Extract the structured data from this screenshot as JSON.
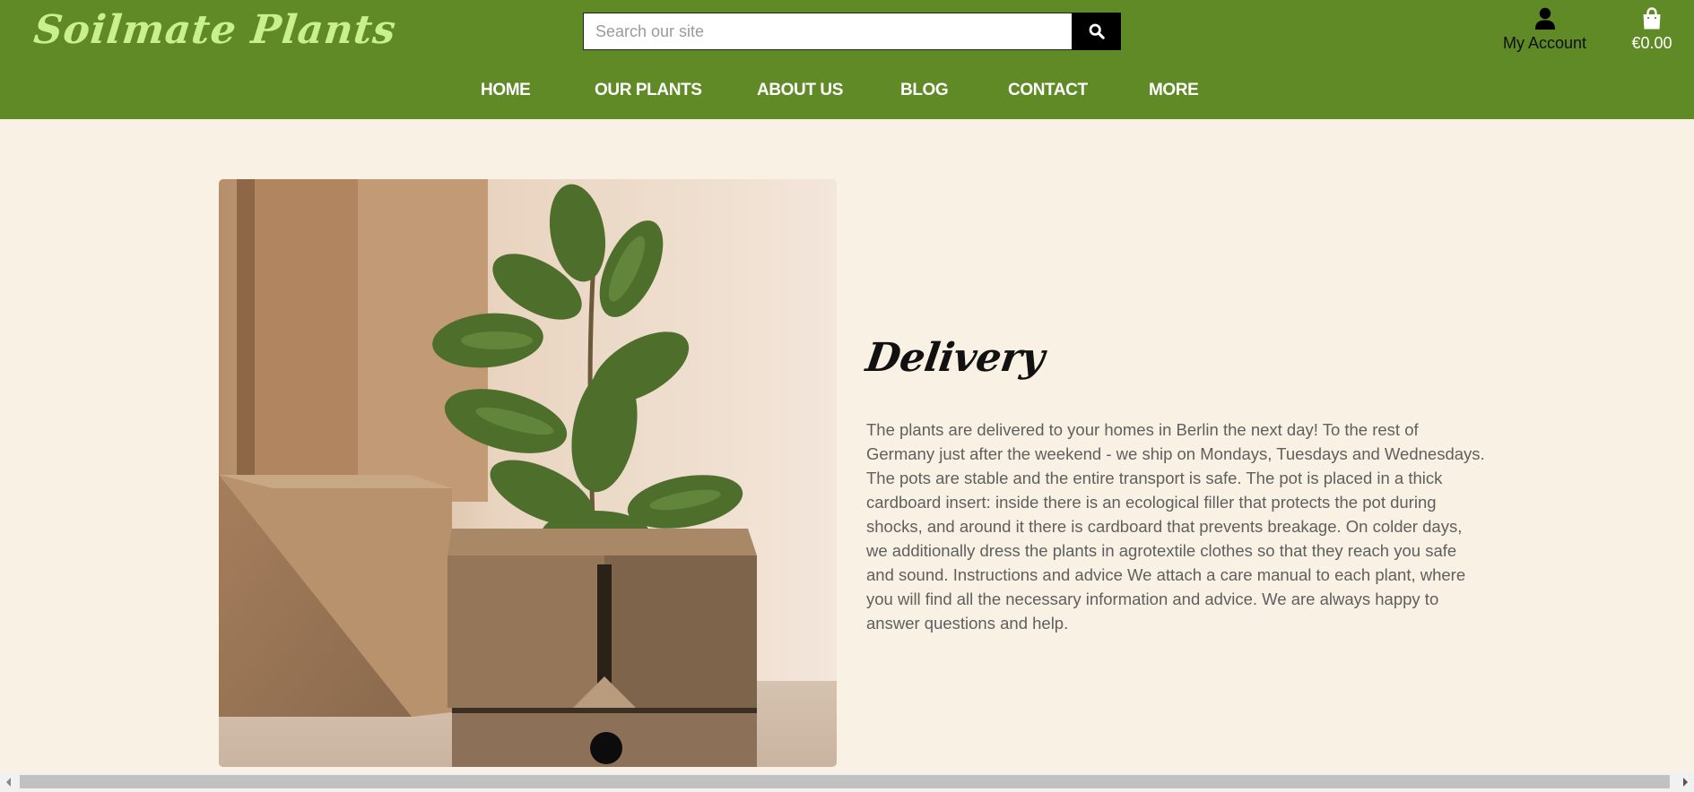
{
  "header": {
    "logo_text": "Soilmate Plants",
    "search_placeholder": "Search our site",
    "search_button_icon": "search-icon",
    "account": {
      "icon": "user-icon",
      "label": "My Account"
    },
    "cart": {
      "icon": "shopping-bag-icon",
      "total": "€0.00"
    }
  },
  "nav": {
    "items": [
      {
        "label": "HOME"
      },
      {
        "label": "OUR PLANTS"
      },
      {
        "label": "ABOUT US"
      },
      {
        "label": "BLOG"
      },
      {
        "label": "CONTACT"
      },
      {
        "label": "MORE"
      }
    ]
  },
  "main": {
    "image_subject": "fiddle-leaf fig plant in cardboard delivery box",
    "title": "Delivery",
    "body": "The plants are delivered to your homes in Berlin the next day! To the rest of Germany just after the weekend - we ship on Mondays, Tuesdays and Wednesdays. The pots are stable and the entire transport is safe. The pot is placed in a thick cardboard insert: inside there is an ecological filler that protects the pot during shocks, and around it there is cardboard that prevents breakage. On colder days, we additionally dress the plants in agrotextile clothes so that they reach you safe and sound. Instructions and advice We attach a care manual to each plant, where you will find all the necessary information and advice. We are always happy to answer questions and help."
  },
  "colors": {
    "header_bg": "#5f8a26",
    "logo": "#c9f08a",
    "page_bg": "#f9f1e4",
    "body_text": "#5f5f5f"
  }
}
